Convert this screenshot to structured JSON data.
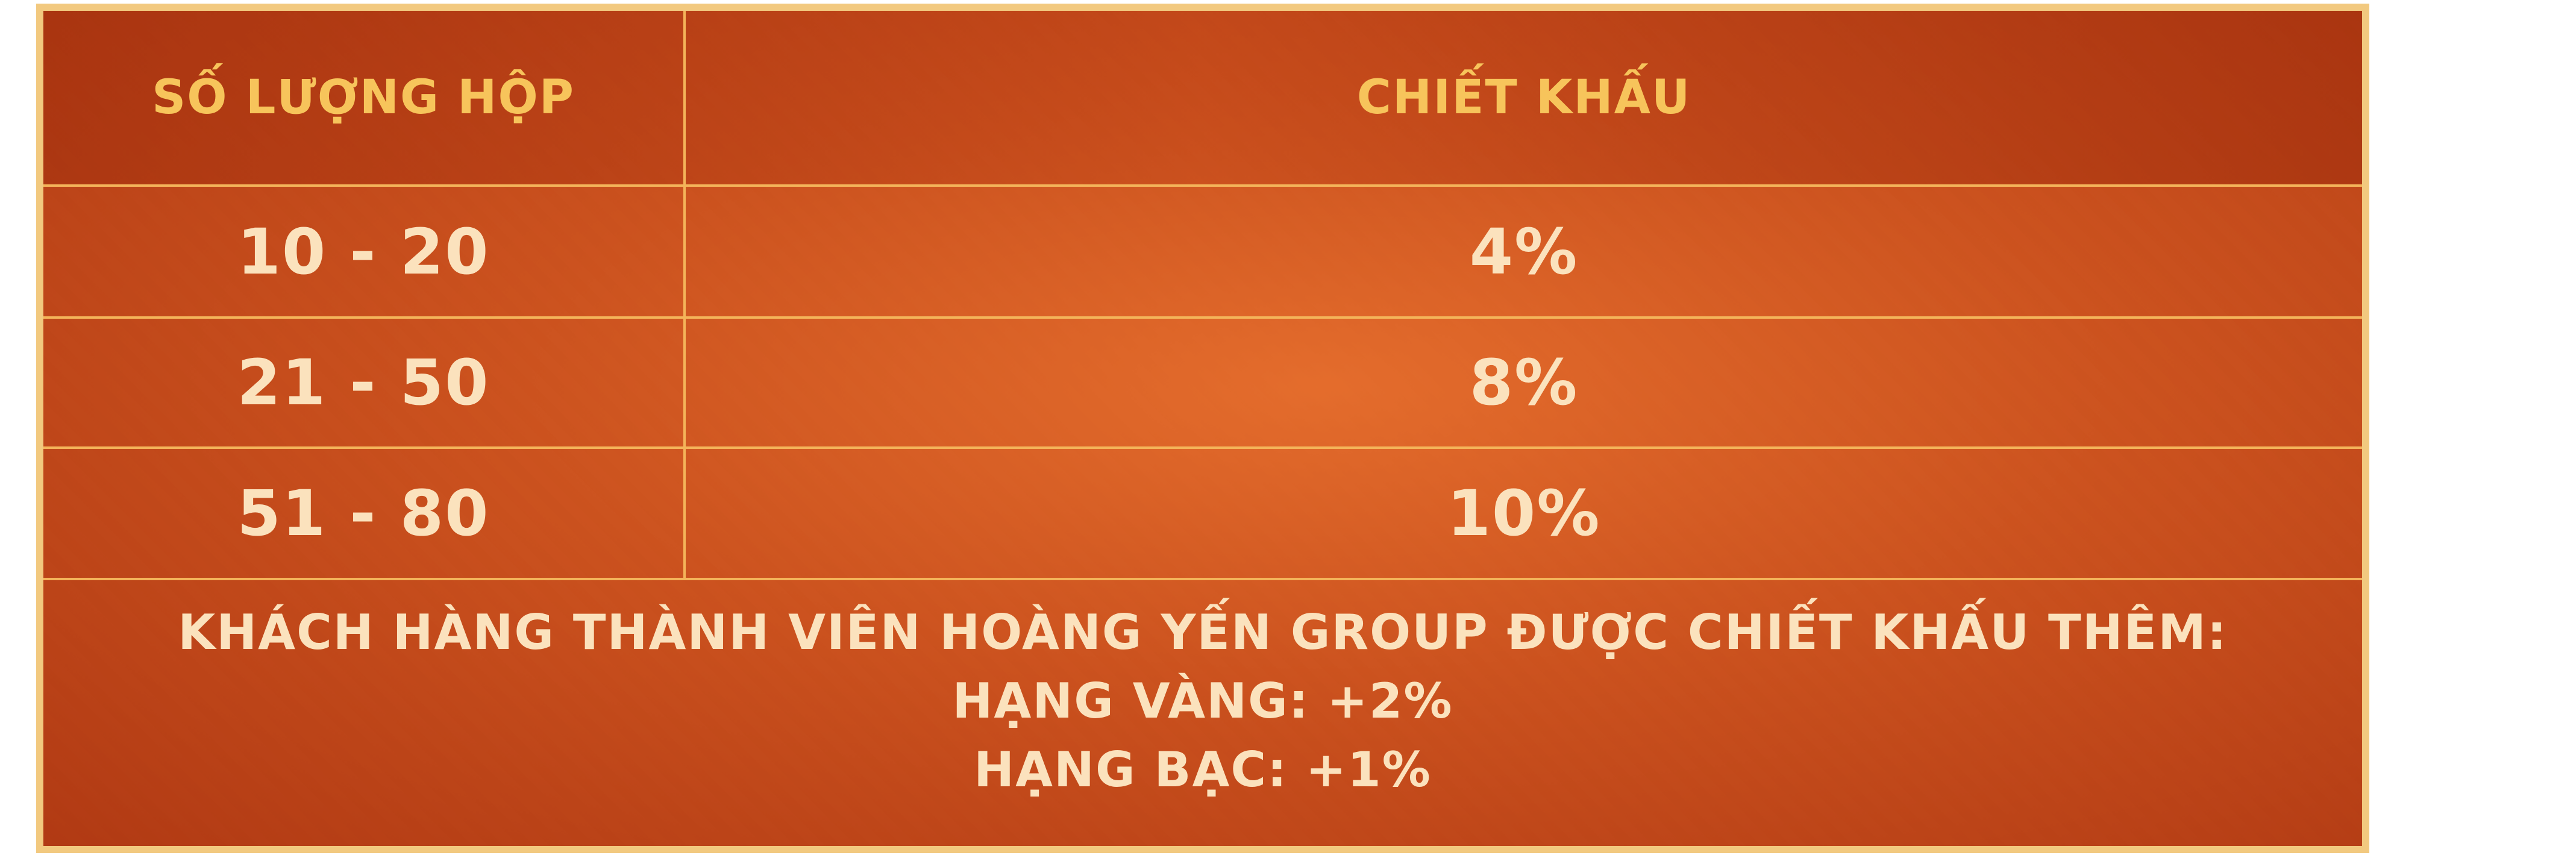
{
  "table": {
    "headers": {
      "quantity": "SỐ LƯỢNG HỘP",
      "discount": "CHIẾT KHẤU"
    },
    "rows": [
      {
        "quantity": "10 - 20",
        "discount": "4%"
      },
      {
        "quantity": "21 - 50",
        "discount": "8%"
      },
      {
        "quantity": "51 - 80",
        "discount": "10%"
      }
    ]
  },
  "note": {
    "line1": "KHÁCH HÀNG THÀNH VIÊN HOÀNG YẾN GROUP ĐƯỢC CHIẾT KHẤU THÊM:",
    "line2": "HẠNG VÀNG: +2%",
    "line3": "HẠNG BẠC: +1%"
  },
  "colors": {
    "border": "#f2c97f",
    "header_text": "#f7c45b",
    "body_text": "#fbe2bd",
    "background": "#c4511f",
    "grid_line": "#f4b45a"
  }
}
